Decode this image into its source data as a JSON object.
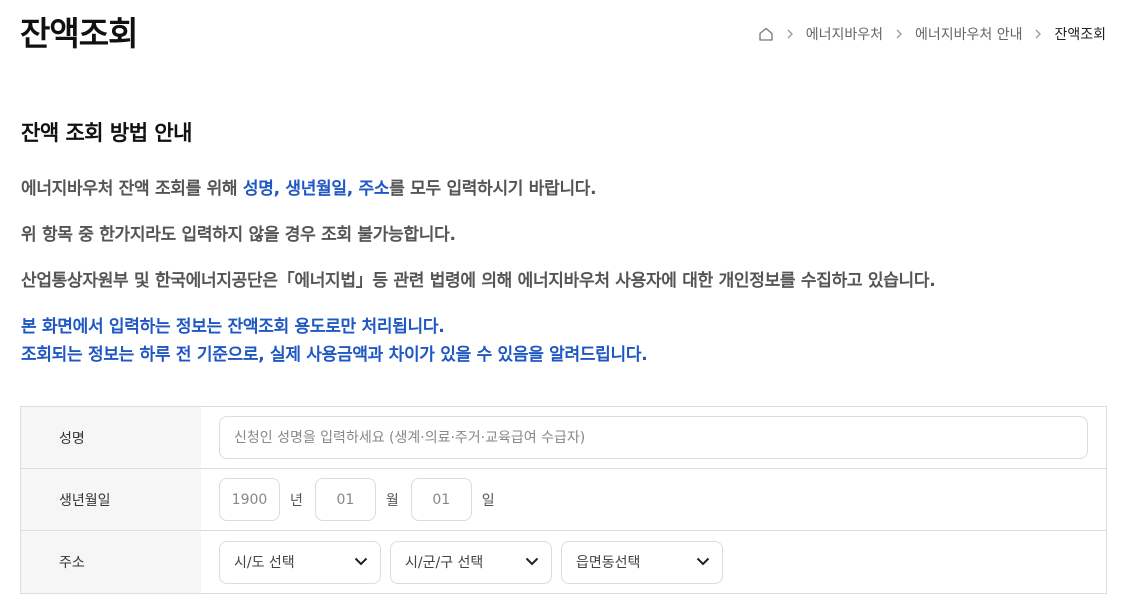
{
  "page_title": "잔액조회",
  "breadcrumb": {
    "home_icon": "home-icon",
    "items": [
      "에너지바우처",
      "에너지바우처 안내",
      "잔액조회"
    ]
  },
  "section_title": "잔액 조회 방법 안내",
  "paragraphs": {
    "p1": {
      "prefix": "에너지바우처 잔액 조회를 위해 ",
      "highlight": "성명, 생년월일, 주소",
      "suffix": "를 모두 입력하시기 바랍니다."
    },
    "p2": "위 항목 중 한가지라도 입력하지 않을 경우 조회 불가능합니다.",
    "p3": "산업통상자원부 및 한국에너지공단은「에너지법」등 관련 법령에 의해 에너지바우처 사용자에 대한 개인정보를 수집하고 있습니다.",
    "notice_1": "본 화면에서 입력하는 정보는 잔액조회 용도로만 처리됩니다.",
    "notice_2": "조회되는 정보는 하루 전 기준으로, 실제 사용금액과 차이가 있을 수 있음을 알려드립니다."
  },
  "form": {
    "name": {
      "label": "성명",
      "value": "",
      "placeholder": "신청인 성명을 입력하세요 (생계·의료·주거·교육급여 수급자)"
    },
    "birth": {
      "label": "생년월일",
      "year": {
        "value": "",
        "placeholder": "1900",
        "unit": "년"
      },
      "month": {
        "value": "",
        "placeholder": "01",
        "unit": "월"
      },
      "day": {
        "value": "",
        "placeholder": "01",
        "unit": "일"
      }
    },
    "address": {
      "label": "주소",
      "sido": "시/도 선택",
      "sigungu": "시/군/구 선택",
      "eupmyeondong": "읍면동선택"
    }
  },
  "colors": {
    "highlight": "#1f57c3",
    "label_bg": "#f6f6f6",
    "border": "#dddddd"
  }
}
